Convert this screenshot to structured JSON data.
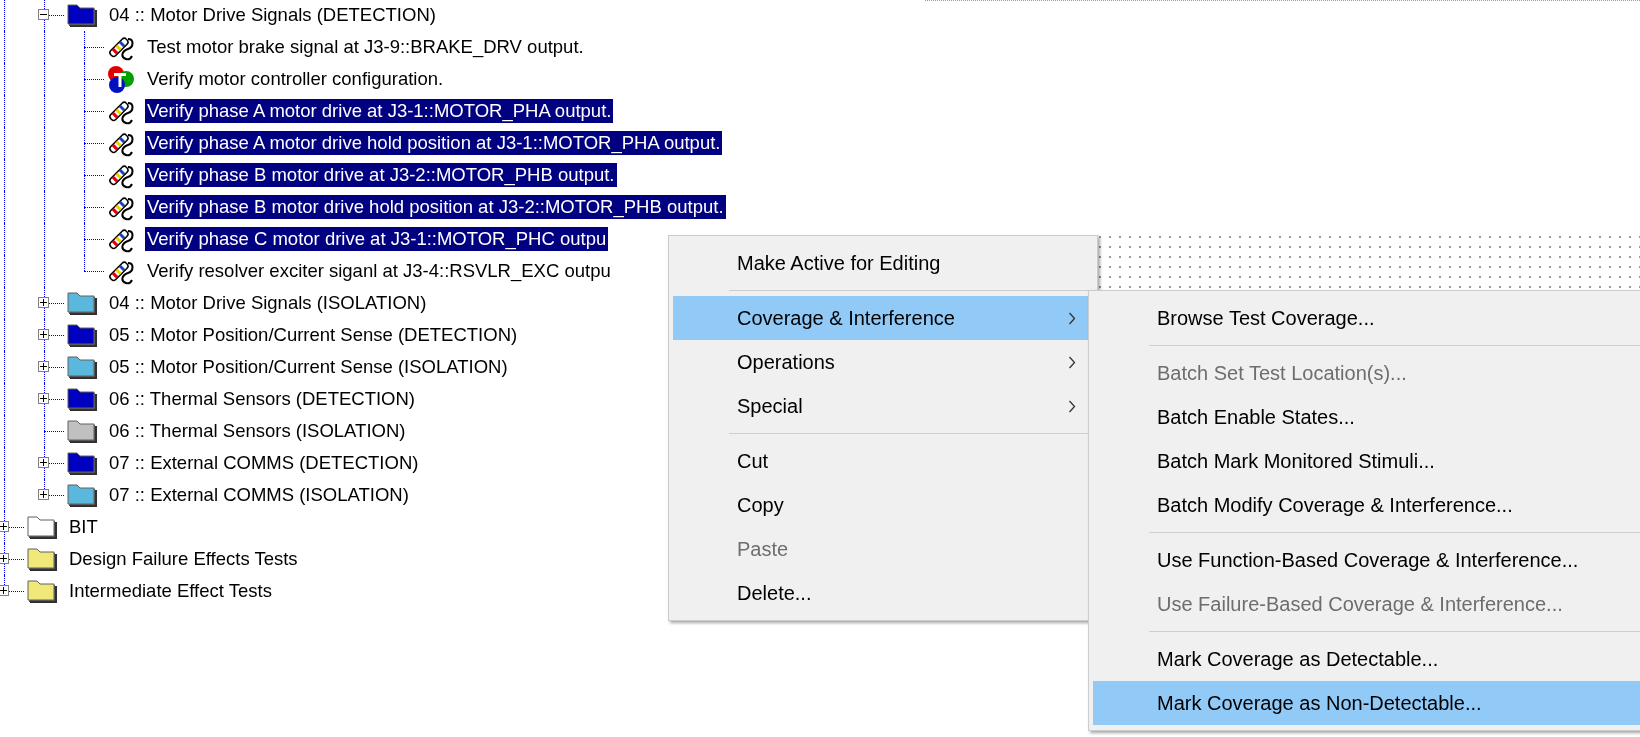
{
  "tree": {
    "nodes": [
      {
        "children": [
          {
            "kind": "folder",
            "label": "04 :: Motor Drive Signals (DETECTION)",
            "color": "#0000c0",
            "expanded": true,
            "selected": false,
            "children": [
              {
                "kind": "test",
                "label": "Test motor brake signal at J3-9::BRAKE_DRV output.",
                "selected": false
              },
              {
                "kind": "config",
                "label": "Verify motor controller configuration.",
                "selected": false
              },
              {
                "kind": "test",
                "label": "Verify phase A motor drive at J3-1::MOTOR_PHA output.",
                "selected": true
              },
              {
                "kind": "test",
                "label": "Verify phase A motor drive hold position at J3-1::MOTOR_PHA output.",
                "selected": true
              },
              {
                "kind": "test",
                "label": "Verify phase B motor drive at J3-2::MOTOR_PHB output.",
                "selected": true
              },
              {
                "kind": "test",
                "label": "Verify phase B motor drive hold position at J3-2::MOTOR_PHB output.",
                "selected": true
              },
              {
                "kind": "test",
                "label": "Verify phase C motor drive at J3-1::MOTOR_PHC outpu",
                "selected": true
              },
              {
                "kind": "test",
                "label": "Verify resolver exciter siganl at J3-4::RSVLR_EXC outpu",
                "selected": false
              }
            ]
          },
          {
            "kind": "folder",
            "label": "04 :: Motor Drive Signals (ISOLATION)",
            "color": "#5ab8dc",
            "expanded": false,
            "selected": false
          },
          {
            "kind": "folder",
            "label": "05 :: Motor Position/Current Sense (DETECTION)",
            "color": "#0000c0",
            "expanded": false,
            "selected": false
          },
          {
            "kind": "folder",
            "label": "05 :: Motor Position/Current Sense (ISOLATION)",
            "color": "#5ab8dc",
            "expanded": false,
            "selected": false
          },
          {
            "kind": "folder",
            "label": "06 :: Thermal Sensors (DETECTION)",
            "color": "#0000c0",
            "expanded": false,
            "selected": false
          },
          {
            "kind": "folder",
            "label": "06 :: Thermal Sensors (ISOLATION)",
            "color": "#c0c0c0",
            "selected": false
          },
          {
            "kind": "folder",
            "label": "07 :: External COMMS (DETECTION)",
            "color": "#0000c0",
            "expanded": false,
            "selected": false
          },
          {
            "kind": "folder",
            "label": "07 :: External COMMS (ISOLATION)",
            "color": "#5ab8dc",
            "expanded": false,
            "selected": false
          }
        ]
      },
      {
        "kind": "folder",
        "label": "BIT",
        "color": "#ffffff",
        "expanded": false,
        "selected": false
      },
      {
        "kind": "folder",
        "label": "Design Failure Effects Tests",
        "color": "#f0e878",
        "expanded": false,
        "selected": false
      },
      {
        "kind": "folder",
        "label": "Intermediate Effect Tests",
        "color": "#f0e878",
        "expanded": false,
        "selected": false
      }
    ]
  },
  "context_menu": {
    "items": [
      {
        "kind": "item",
        "label": "Make Active for Editing",
        "submenu": false,
        "disabled": false,
        "selected": false
      },
      {
        "kind": "separator"
      },
      {
        "kind": "item",
        "label": "Coverage & Interference",
        "submenu": true,
        "disabled": false,
        "selected": true
      },
      {
        "kind": "item",
        "label": "Operations",
        "submenu": true,
        "disabled": false,
        "selected": false
      },
      {
        "kind": "item",
        "label": "Special",
        "submenu": true,
        "disabled": false,
        "selected": false
      },
      {
        "kind": "separator"
      },
      {
        "kind": "item",
        "label": "Cut",
        "submenu": false,
        "disabled": false,
        "selected": false
      },
      {
        "kind": "item",
        "label": "Copy",
        "submenu": false,
        "disabled": false,
        "selected": false
      },
      {
        "kind": "item",
        "label": "Paste",
        "submenu": false,
        "disabled": true,
        "selected": false
      },
      {
        "kind": "item",
        "label": "Delete...",
        "submenu": false,
        "disabled": false,
        "selected": false
      }
    ]
  },
  "submenu": {
    "items": [
      {
        "kind": "item",
        "label": "Browse Test Coverage...",
        "submenu": false,
        "disabled": false,
        "selected": false
      },
      {
        "kind": "separator"
      },
      {
        "kind": "item",
        "label": "Batch Set Test Location(s)...",
        "submenu": false,
        "disabled": true,
        "selected": false
      },
      {
        "kind": "item",
        "label": "Batch Enable States...",
        "submenu": false,
        "disabled": false,
        "selected": false
      },
      {
        "kind": "item",
        "label": "Batch Mark Monitored Stimuli...",
        "submenu": false,
        "disabled": false,
        "selected": false
      },
      {
        "kind": "item",
        "label": "Batch Modify Coverage & Interference...",
        "submenu": false,
        "disabled": false,
        "selected": false
      },
      {
        "kind": "separator"
      },
      {
        "kind": "item",
        "label": "Use Function-Based Coverage & Interference...",
        "submenu": false,
        "disabled": false,
        "selected": false
      },
      {
        "kind": "item",
        "label": "Use Failure-Based Coverage & Interference...",
        "submenu": false,
        "disabled": true,
        "selected": false
      },
      {
        "kind": "separator"
      },
      {
        "kind": "item",
        "label": "Mark Coverage as Detectable...",
        "submenu": false,
        "disabled": false,
        "selected": false
      },
      {
        "kind": "item",
        "label": "Mark Coverage as Non-Detectable...",
        "submenu": false,
        "disabled": false,
        "selected": true
      }
    ]
  }
}
